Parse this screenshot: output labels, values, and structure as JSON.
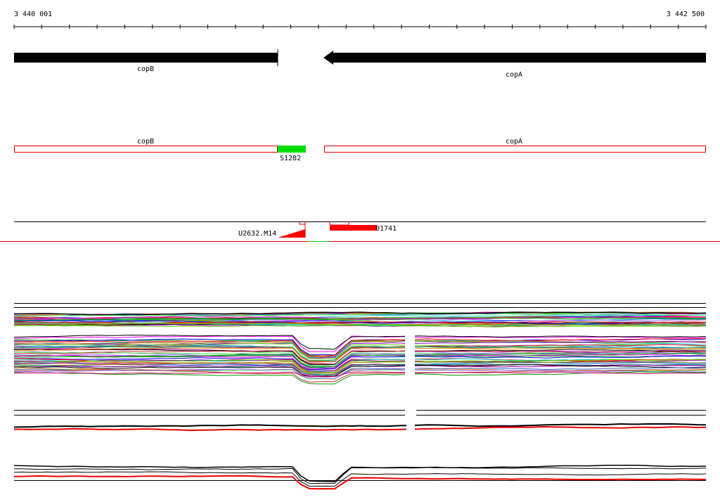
{
  "ruler": {
    "start_label": "3 440 001",
    "end_label": "3 442 500"
  },
  "genes": [
    {
      "name": "copB",
      "strand": "+"
    },
    {
      "name": "copA",
      "strand": "-"
    }
  ],
  "annotation_track": {
    "features": [
      {
        "label": "copB"
      },
      {
        "label": "copA"
      },
      {
        "label": "S1282"
      }
    ]
  },
  "oligo_track": {
    "features": [
      {
        "label": "U2632.M14"
      },
      {
        "label": "01741"
      }
    ]
  },
  "colors": {
    "gene_arrow": "#000000",
    "feature_outline": "#cc0000",
    "highlight_feature": "#00dd00",
    "probe": "#ff0000",
    "baseline_red": "#dd0000"
  }
}
